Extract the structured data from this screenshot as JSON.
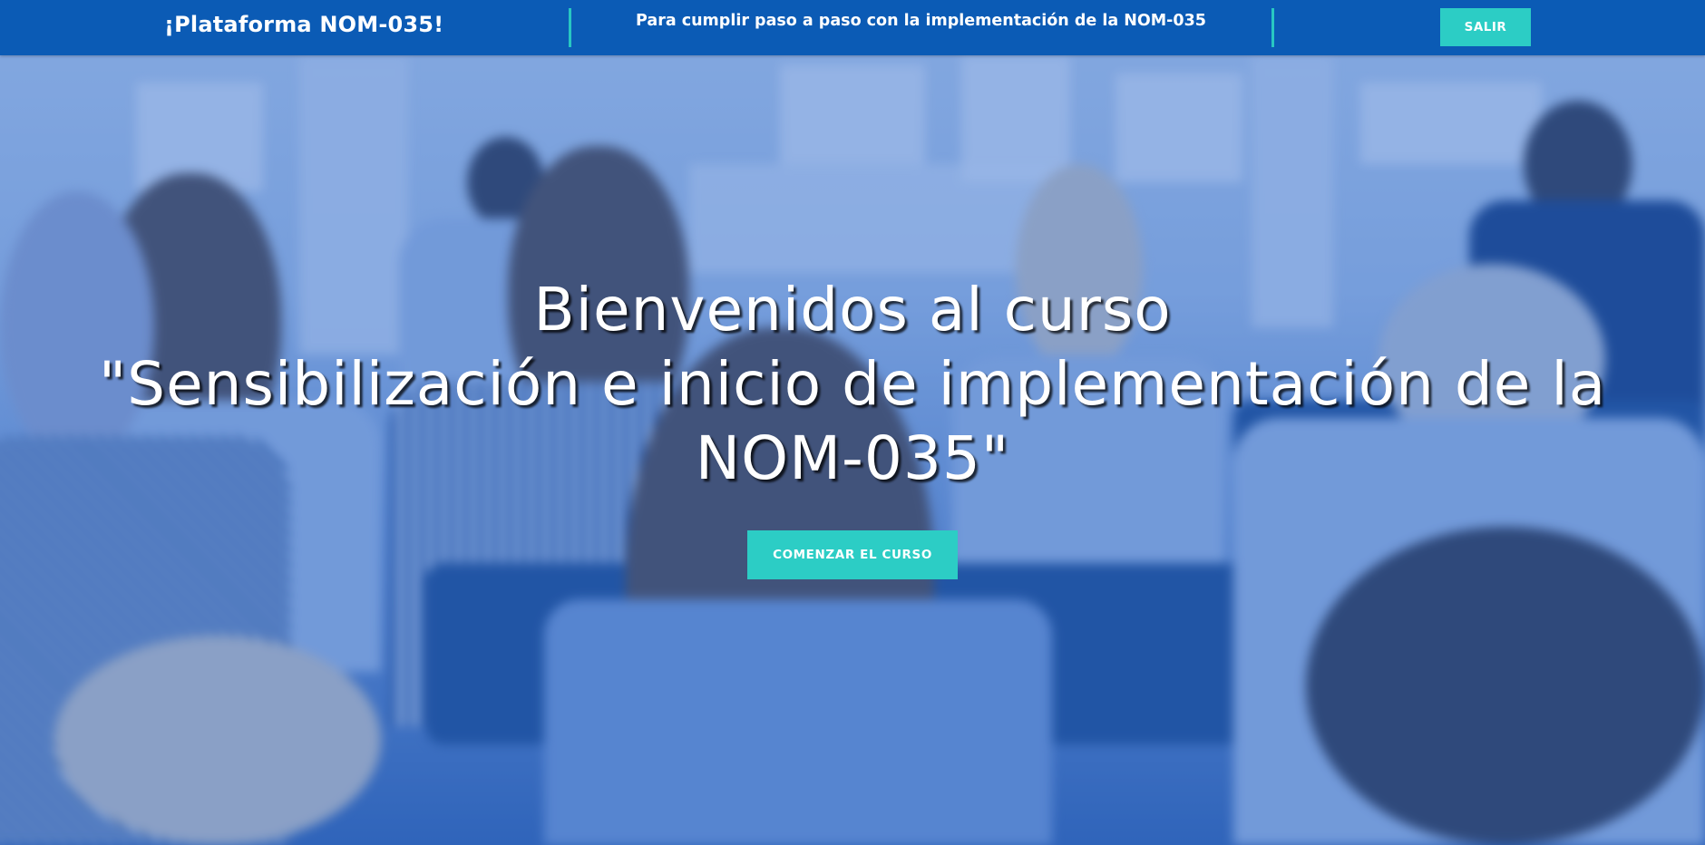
{
  "header": {
    "brand": "¡Plataforma NOM-035!",
    "tagline": "Para cumplir paso a paso con la implementación de la NOM-035",
    "exit_label": "SALIR"
  },
  "hero": {
    "title_line1": "Bienvenidos al curso",
    "title_line2": "\"Sensibilización e inicio de implementación de la",
    "title_line3": "NOM-035\"",
    "cta_label": "COMENZAR EL CURSO"
  },
  "colors": {
    "navbar": "#0b5bb5",
    "accent": "#2ccdc5",
    "divider": "#28c7c2",
    "text": "#ffffff"
  }
}
